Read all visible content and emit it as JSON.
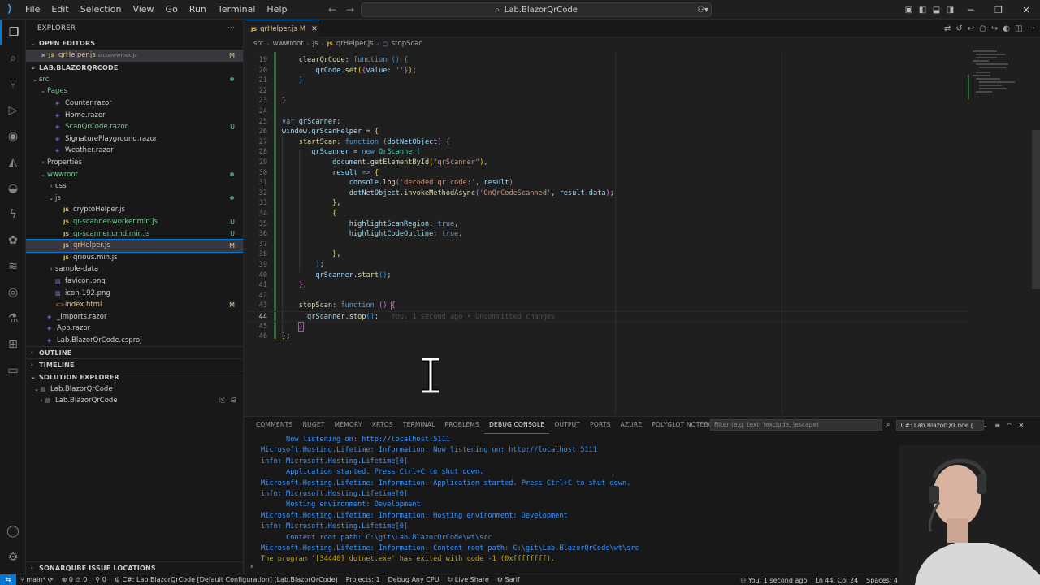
{
  "window": {
    "menus": [
      "File",
      "Edit",
      "Selection",
      "View",
      "Go",
      "Run",
      "Terminal",
      "Help"
    ],
    "search": "Lab.BlazorQrCode"
  },
  "sidebar": {
    "title": "EXPLORER",
    "open_editors_label": "OPEN EDITORS",
    "open_editor": {
      "name": "qrHelper.js",
      "path": "src\\wwwroot\\js",
      "badge": "M"
    },
    "project_label": "LAB.BLAZORQRCODE",
    "tree": [
      {
        "label": "src",
        "indent": 0,
        "chev": "⌄",
        "kind": "folder",
        "badge": "",
        "dot": true,
        "color": "untr"
      },
      {
        "label": "Pages",
        "indent": 1,
        "chev": "⌄",
        "kind": "folder",
        "badge": "",
        "dot": false,
        "color": "untr"
      },
      {
        "label": "Counter.razor",
        "indent": 2,
        "chev": "",
        "kind": "razor",
        "badge": "",
        "dot": false,
        "color": ""
      },
      {
        "label": "Home.razor",
        "indent": 2,
        "chev": "",
        "kind": "razor",
        "badge": "",
        "dot": false,
        "color": ""
      },
      {
        "label": "ScanQrCode.razor",
        "indent": 2,
        "chev": "",
        "kind": "razor",
        "badge": "U",
        "dot": false,
        "color": "untr"
      },
      {
        "label": "SignaturePlayground.razor",
        "indent": 2,
        "chev": "",
        "kind": "razor",
        "badge": "",
        "dot": false,
        "color": ""
      },
      {
        "label": "Weather.razor",
        "indent": 2,
        "chev": "",
        "kind": "razor",
        "badge": "",
        "dot": false,
        "color": ""
      },
      {
        "label": "Properties",
        "indent": 1,
        "chev": "›",
        "kind": "folder",
        "badge": "",
        "dot": false,
        "color": ""
      },
      {
        "label": "wwwroot",
        "indent": 1,
        "chev": "⌄",
        "kind": "folder",
        "badge": "",
        "dot": true,
        "color": "untr"
      },
      {
        "label": "css",
        "indent": 2,
        "chev": "›",
        "kind": "folder",
        "badge": "",
        "dot": false,
        "color": ""
      },
      {
        "label": "js",
        "indent": 2,
        "chev": "⌄",
        "kind": "folder",
        "badge": "",
        "dot": true,
        "color": "untr"
      },
      {
        "label": "cryptoHelper.js",
        "indent": 3,
        "chev": "",
        "kind": "js",
        "badge": "",
        "dot": false,
        "color": ""
      },
      {
        "label": "qr-scanner-worker.min.js",
        "indent": 3,
        "chev": "",
        "kind": "js",
        "badge": "U",
        "dot": false,
        "color": "untr"
      },
      {
        "label": "qr-scanner.umd.min.js",
        "indent": 3,
        "chev": "",
        "kind": "js",
        "badge": "U",
        "dot": false,
        "color": "untr"
      },
      {
        "label": "qrHelper.js",
        "indent": 3,
        "chev": "",
        "kind": "js",
        "badge": "M",
        "dot": false,
        "color": "mod",
        "selected": true
      },
      {
        "label": "qrious.min.js",
        "indent": 3,
        "chev": "",
        "kind": "js",
        "badge": "",
        "dot": false,
        "color": ""
      },
      {
        "label": "sample-data",
        "indent": 2,
        "chev": "›",
        "kind": "folder",
        "badge": "",
        "dot": false,
        "color": ""
      },
      {
        "label": "favicon.png",
        "indent": 2,
        "chev": "",
        "kind": "img",
        "badge": "",
        "dot": false,
        "color": ""
      },
      {
        "label": "icon-192.png",
        "indent": 2,
        "chev": "",
        "kind": "img",
        "badge": "",
        "dot": false,
        "color": ""
      },
      {
        "label": "index.html",
        "indent": 2,
        "chev": "",
        "kind": "html",
        "badge": "M",
        "dot": false,
        "color": "mod"
      },
      {
        "label": "_Imports.razor",
        "indent": 1,
        "chev": "",
        "kind": "razor",
        "badge": "",
        "dot": false,
        "color": ""
      },
      {
        "label": "App.razor",
        "indent": 1,
        "chev": "",
        "kind": "razor",
        "badge": "",
        "dot": false,
        "color": ""
      },
      {
        "label": "Lab.BlazorQrCode.csproj",
        "indent": 1,
        "chev": "",
        "kind": "csproj",
        "badge": "",
        "dot": false,
        "color": ""
      }
    ],
    "outline_label": "OUTLINE",
    "timeline_label": "TIMELINE",
    "solution_label": "SOLUTION EXPLORER",
    "solution_items": [
      "Lab.BlazorQrCode",
      "Lab.BlazorQrCode"
    ],
    "sonar_label": "SONARQUBE ISSUE LOCATIONS"
  },
  "editor": {
    "tab_label": "qrHelper.js",
    "tab_badge": "M",
    "breadcrumb": [
      "src",
      "wwwroot",
      "js",
      "qrHelper.js",
      "stopScan"
    ],
    "blame": "You, 1 second ago • Uncommitted changes",
    "line_numbers": [
      "19",
      "20",
      "21",
      "22",
      "23",
      "24",
      "25",
      "26",
      "27",
      "28",
      "29",
      "30",
      "31",
      "32",
      "33",
      "34",
      "35",
      "36",
      "37",
      "38",
      "39",
      "40",
      "41",
      "42",
      "43",
      "44",
      "45",
      "46"
    ]
  },
  "panel": {
    "tabs": [
      "COMMENTS",
      "NUGET",
      "MEMORY",
      "XRTOS",
      "TERMINAL",
      "PROBLEMS",
      "DEBUG CONSOLE",
      "OUTPUT",
      "PORTS",
      "AZURE",
      "POLYGLOT NOTEBOOK"
    ],
    "active_tab": "DEBUG CONSOLE",
    "filter_placeholder": "Filter (e.g. text, !exclude, \\escape)",
    "console_select": "C#: Lab.BlazorQrCode [",
    "lines": [
      {
        "text": "      Now listening on: http://localhost:5111",
        "cls": ""
      },
      {
        "text": "Microsoft.Hosting.Lifetime: Information: Now listening on: http://localhost:5111",
        "cls": ""
      },
      {
        "text": "info: Microsoft.Hosting.Lifetime[0]",
        "cls": ""
      },
      {
        "text": "      Application started. Press Ctrl+C to shut down.",
        "cls": ""
      },
      {
        "text": "Microsoft.Hosting.Lifetime: Information: Application started. Press Ctrl+C to shut down.",
        "cls": ""
      },
      {
        "text": "info: Microsoft.Hosting.Lifetime[0]",
        "cls": ""
      },
      {
        "text": "      Hosting environment: Development",
        "cls": ""
      },
      {
        "text": "Microsoft.Hosting.Lifetime: Information: Hosting environment: Development",
        "cls": ""
      },
      {
        "text": "info: Microsoft.Hosting.Lifetime[0]",
        "cls": ""
      },
      {
        "text": "      Content root path: C:\\git\\Lab.BlazorQrCode\\wt\\src",
        "cls": ""
      },
      {
        "text": "Microsoft.Hosting.Lifetime: Information: Content root path: C:\\git\\Lab.BlazorQrCode\\wt\\src",
        "cls": ""
      },
      {
        "text": "The program '[34440] dotnet.exe' has exited with code -1 (0xffffffff).",
        "cls": "yel"
      }
    ]
  },
  "status": {
    "branch": "main*",
    "errors": "0",
    "warnings": "0",
    "ports": "0",
    "project": "C#: Lab.BlazorQrCode [Default Configuration] (Lab.BlazorQrCode)",
    "projects": "Projects: 1",
    "debug": "Debug Any CPU",
    "live_share": "Live Share",
    "sarif": "Sarif",
    "blame": "You, 1 second ago",
    "position": "Ln 44, Col 24",
    "spaces": "Spaces: 4"
  },
  "colors": {
    "accent": "#0078d4",
    "modified": "#e2c08d",
    "untracked": "#73c991"
  }
}
